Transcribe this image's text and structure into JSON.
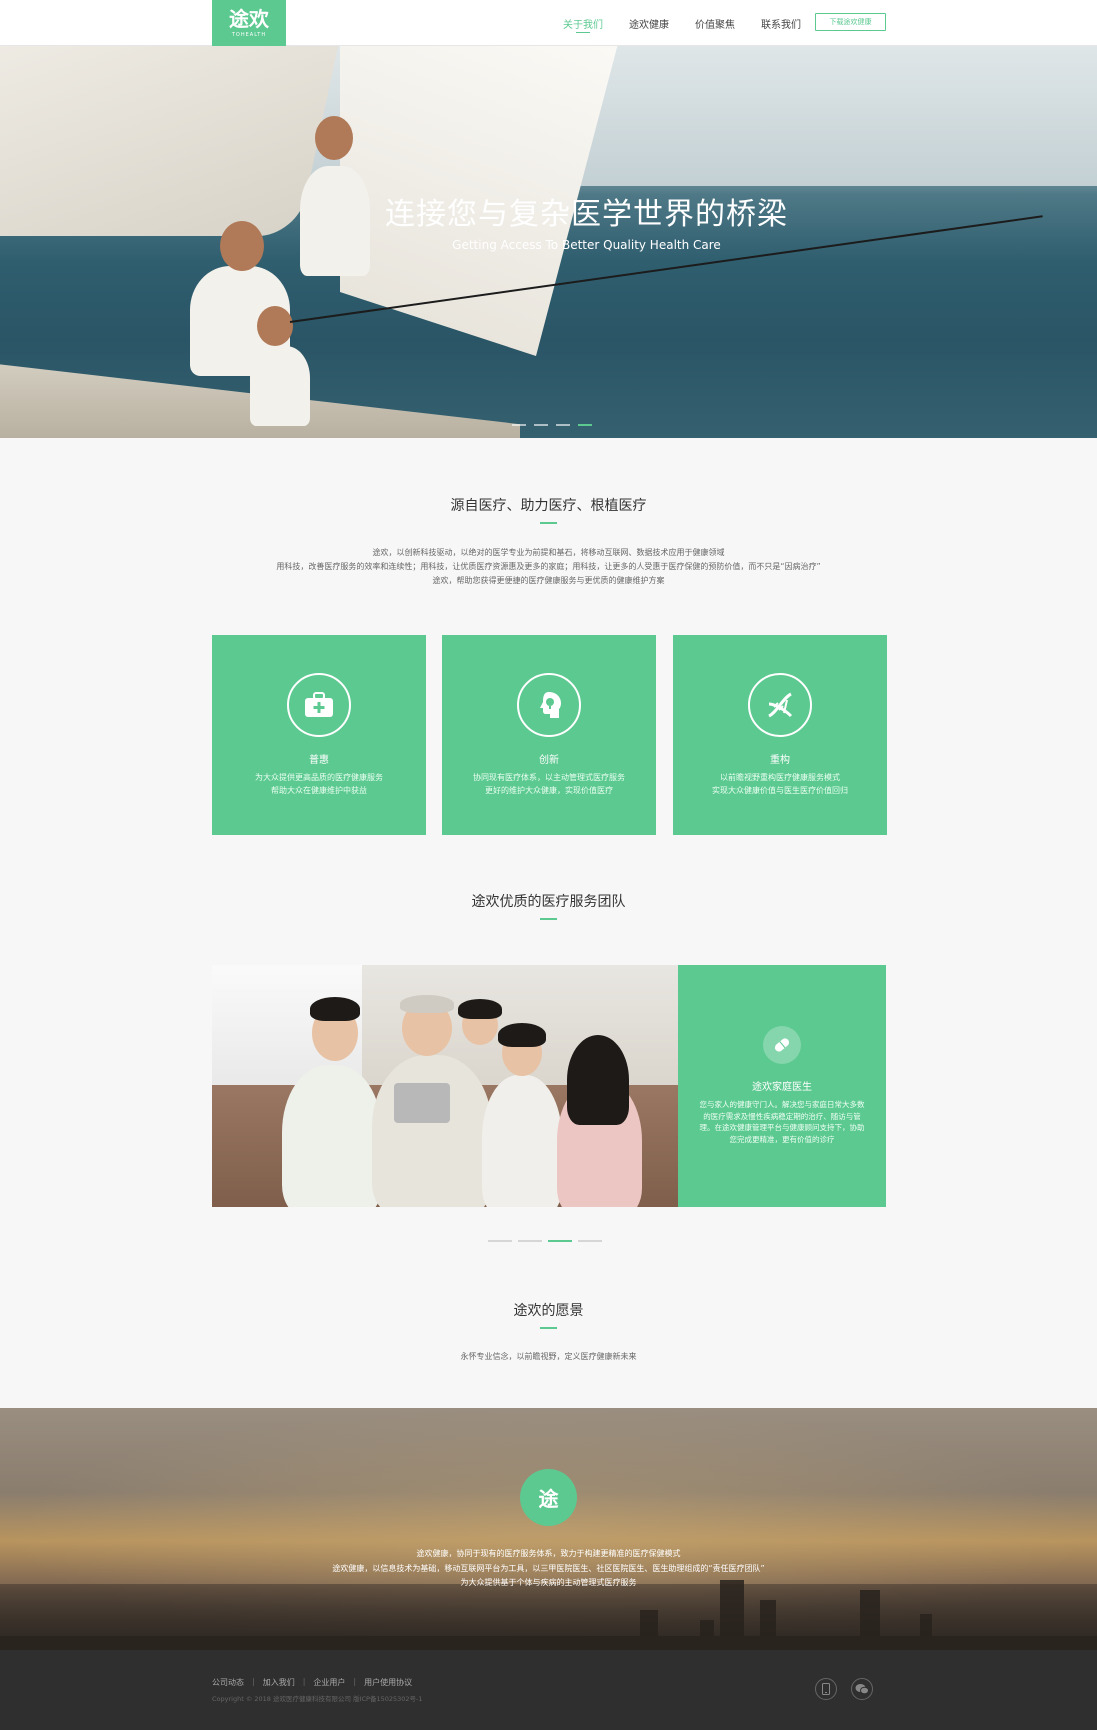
{
  "header": {
    "logo_mark": "途欢",
    "logo_sub": "TOHEALTH",
    "nav": [
      {
        "label": "关于我们",
        "active": true
      },
      {
        "label": "途欢健康",
        "active": false
      },
      {
        "label": "价值聚焦",
        "active": false
      },
      {
        "label": "联系我们",
        "active": false
      }
    ],
    "download_label": "下载途欢健康"
  },
  "hero": {
    "title": "连接您与复杂医学世界的桥梁",
    "subtitle": "Getting Access To Better Quality Health Care"
  },
  "intro": {
    "title": "源自医疗、助力医疗、根植医疗",
    "lines": [
      "途欢，以创新科技驱动，以绝对的医学专业为前提和基石，将移动互联网、数据技术应用于健康领域",
      "用科技，改善医疗服务的效率和连续性；用科技，让优质医疗资源惠及更多的家庭；用科技，让更多的人受惠于医疗保健的预防价值，而不只是“因病治疗”",
      "途欢，帮助您获得更便捷的医疗健康服务与更优质的健康维护方案"
    ]
  },
  "cards": [
    {
      "icon": "medical-kit-icon",
      "title": "普惠",
      "text1": "为大众提供更高品质的医疗健康服务",
      "text2": "帮助大众在健康维护中获益"
    },
    {
      "icon": "idea-head-icon",
      "title": "创新",
      "text1": "协同现有医疗体系，以主动管理式医疗服务",
      "text2": "更好的维护大众健康，实现价值医疗"
    },
    {
      "icon": "dna-icon",
      "title": "重构",
      "text1": "以前瞻视野重构医疗健康服务模式",
      "text2": "实现大众健康价值与医生医疗价值回归"
    }
  ],
  "team": {
    "title": "途欢优质的医疗服务团队",
    "card_title": "途欢家庭医生",
    "card_text": "您与家人的健康守门人。解决您与家庭日常大多数的医疗需求及慢性疾病稳定期的治疗、随访与管理。在途欢健康管理平台与健康顾问支持下，协助您完成更精准，更有价值的诊疗"
  },
  "vision": {
    "title": "途欢的愿景",
    "text": "永怀专业信念，以前瞻视野，定义医疗健康新未来"
  },
  "banner": {
    "icon_text": "途",
    "lines": [
      "途欢健康，协同于现有的医疗服务体系，致力于构建更精准的医疗保健模式",
      "途欢健康，以信息技术为基础，移动互联网平台为工具，以三甲医院医生、社区医院医生、医生助理组成的“责任医疗团队”",
      "为大众提供基于个体与疾病的主动管理式医疗服务"
    ]
  },
  "footer": {
    "links": [
      "公司动态",
      "加入我们",
      "企业用户",
      "用户使用协议"
    ],
    "copyright": "Copyright © 2018 途欢医疗健康科技有限公司 版ICP备15025302号-1"
  },
  "colors": {
    "accent": "#5cc990",
    "footer_bg": "#2f2f2f"
  }
}
